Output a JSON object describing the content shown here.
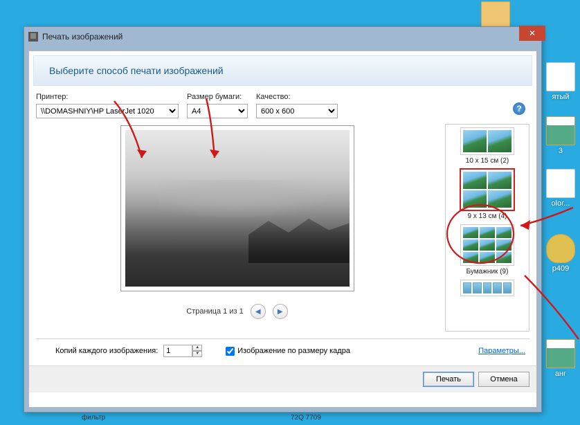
{
  "desktop": {
    "icons": [
      {
        "label": "ятый"
      },
      {
        "label": "3"
      },
      {
        "label": "olor..."
      },
      {
        "label": "p409"
      },
      {
        "label": "анг"
      }
    ]
  },
  "window": {
    "title": "Печать изображений",
    "banner": "Выберите способ печати изображений",
    "printer_label": "Принтер:",
    "printer_value": "\\\\DOMASHNIY\\HP LaserJet 1020",
    "paper_label": "Размер бумаги:",
    "paper_value": "A4",
    "quality_label": "Качество:",
    "quality_value": "600 x 600",
    "page_info": "Страница 1 из 1",
    "layouts": [
      {
        "label": "10 x 15 см (2)"
      },
      {
        "label": "9 x 13 см (4)"
      },
      {
        "label": "Бумажник (9)"
      },
      {
        "label": ""
      }
    ],
    "copies_label": "Копий каждого изображения:",
    "copies_value": "1",
    "fit_label": "Изображение по размеру кадра",
    "params_link": "Параметры...",
    "print_btn": "Печать",
    "cancel_btn": "Отмена"
  },
  "strip": {
    "left": "фильтр",
    "right": "72Q 7709"
  }
}
